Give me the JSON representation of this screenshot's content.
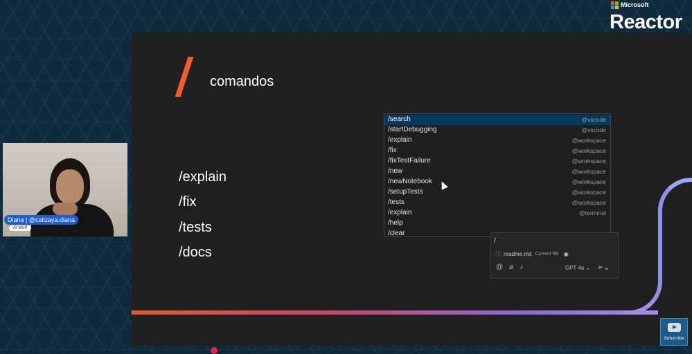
{
  "branding": {
    "company": "Microsoft",
    "product": "Reactor"
  },
  "slide": {
    "title": "comandos",
    "commands": [
      "/explain",
      "/fix",
      "/tests",
      "/docs"
    ]
  },
  "autocomplete": {
    "items": [
      {
        "cmd": "/search",
        "source": "@vscode"
      },
      {
        "cmd": "/startDebugging",
        "source": "@vscode"
      },
      {
        "cmd": "/explain",
        "source": "@workspace"
      },
      {
        "cmd": "/fix",
        "source": "@workspace"
      },
      {
        "cmd": "/fixTestFailure",
        "source": "@workspace"
      },
      {
        "cmd": "/new",
        "source": "@workspace"
      },
      {
        "cmd": "/newNotebook",
        "source": "@workspace"
      },
      {
        "cmd": "/setupTests",
        "source": "@workspace"
      },
      {
        "cmd": "/tests",
        "source": "@workspace"
      },
      {
        "cmd": "/explain",
        "source": "@terminal"
      },
      {
        "cmd": "/help",
        "source": ""
      },
      {
        "cmd": "/clear",
        "source": ""
      }
    ],
    "selected_index": 0
  },
  "chat": {
    "input_value": "/",
    "file_chip": {
      "name": "readme.md",
      "label": "Current file"
    },
    "model": "GPT 4o"
  },
  "speaker": {
    "name_tag": "Diana | @calizaya.diana",
    "role": "AI MVP"
  },
  "youtube": {
    "label": "Subscribe"
  },
  "colors": {
    "slide_bg": "#202020",
    "accent_orange": "#f25b2a",
    "accent_purple": "#9a86e6",
    "selected_item": "#04395e",
    "background": "#0f2a3d"
  }
}
